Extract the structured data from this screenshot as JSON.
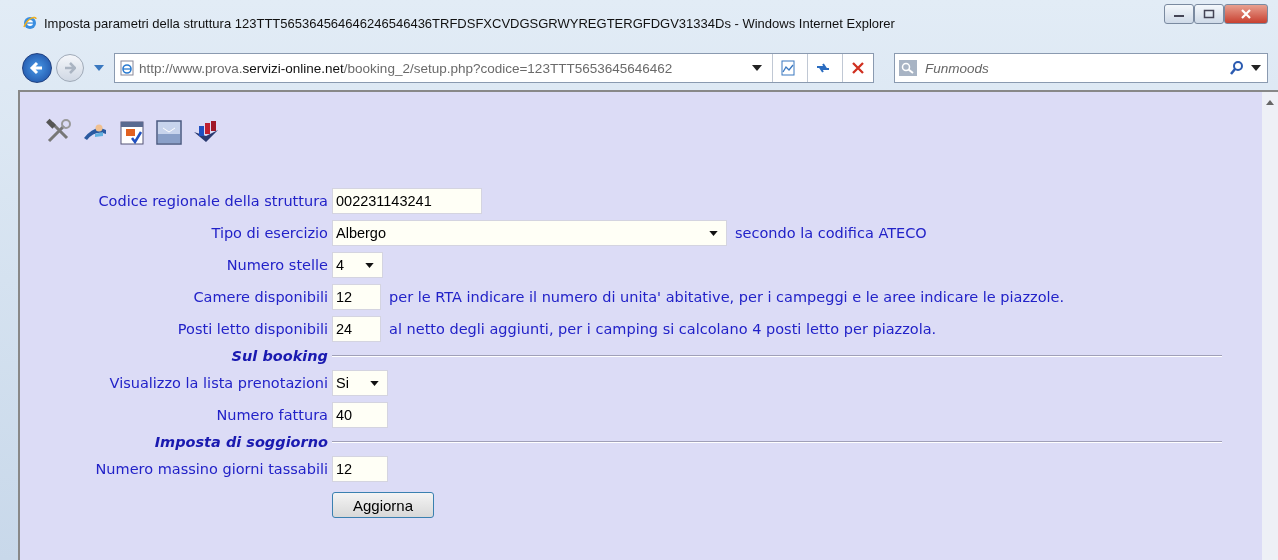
{
  "window": {
    "title": "Imposta parametri della struttura 123TTT565364564646246546436TRFDSFXCVDGSGRWYREGTERGFDGV31334Ds - Windows Internet Explorer"
  },
  "address_bar": {
    "before": "http://www.prova.",
    "domain": "servizi-online.net",
    "after": "/booking_2/setup.php?codice=123TTT5653645646462"
  },
  "search": {
    "placeholder": "Funmoods"
  },
  "form": {
    "rows": [
      {
        "kind": "text",
        "label": "Codice regionale della struttura",
        "value": "002231143241"
      },
      {
        "kind": "select",
        "label": "Tipo di esercizio",
        "value": "Albergo",
        "note": "secondo la codifica ATECO"
      },
      {
        "kind": "select",
        "label": "Numero stelle",
        "value": "4"
      },
      {
        "kind": "text",
        "label": "Camere disponibili",
        "value": "12",
        "note": "per le RTA indicare il numero di unita' abitative, per i campeggi e le aree indicare le piazzole."
      },
      {
        "kind": "text",
        "label": "Posti letto disponibili",
        "value": "24",
        "note": "al netto degli aggiunti, per i camping si calcolano 4 posti letto per piazzola."
      },
      {
        "kind": "section",
        "label": "Sul booking"
      },
      {
        "kind": "select",
        "label": "Visualizzo la lista prenotazioni",
        "value": "Si"
      },
      {
        "kind": "text",
        "label": "Numero fattura",
        "value": "40"
      },
      {
        "kind": "section",
        "label": "Imposta di soggiorno"
      },
      {
        "kind": "text",
        "label": "Numero massino giorni tassabili",
        "value": "12"
      }
    ],
    "submit": "Aggiorna"
  }
}
